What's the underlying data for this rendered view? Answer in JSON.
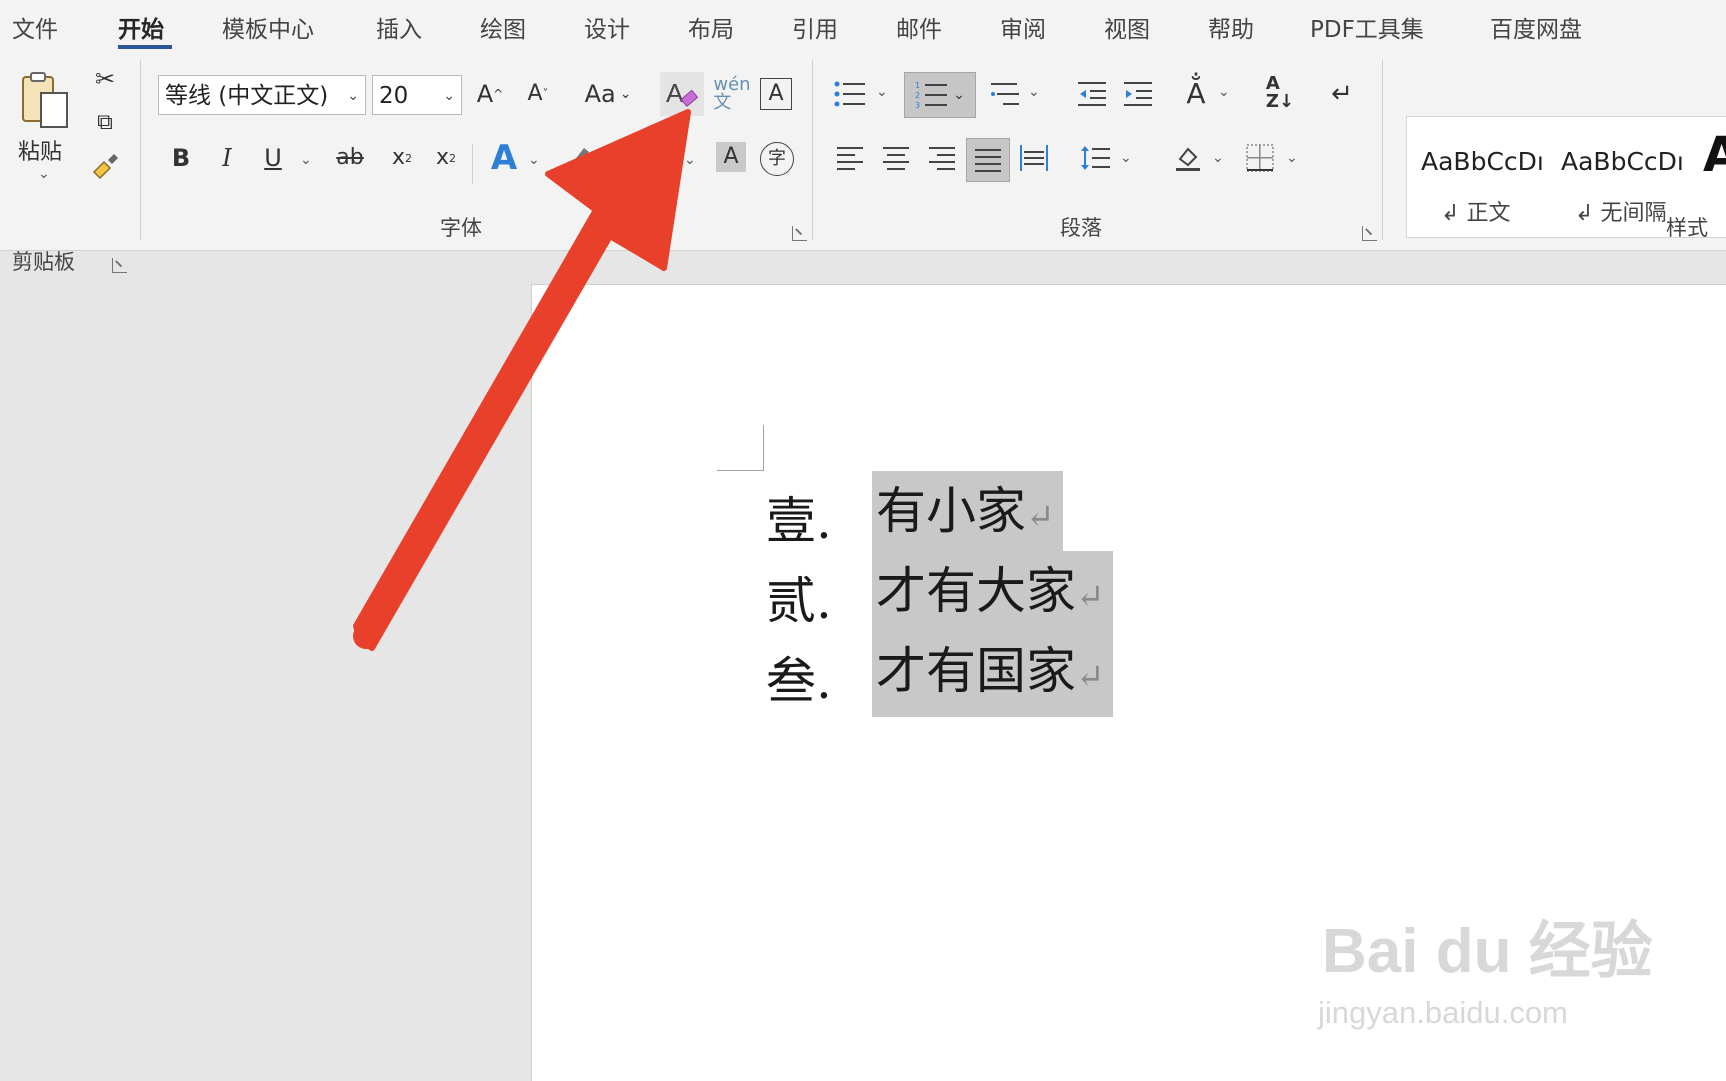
{
  "tabs": [
    {
      "label": "文件"
    },
    {
      "label": "开始",
      "active": true
    },
    {
      "label": "模板中心"
    },
    {
      "label": "插入"
    },
    {
      "label": "绘图"
    },
    {
      "label": "设计"
    },
    {
      "label": "布局"
    },
    {
      "label": "引用"
    },
    {
      "label": "邮件"
    },
    {
      "label": "审阅"
    },
    {
      "label": "视图"
    },
    {
      "label": "帮助"
    },
    {
      "label": "PDF工具集"
    },
    {
      "label": "百度网盘"
    }
  ],
  "clipboard": {
    "paste_label": "粘贴",
    "group_label": "剪贴板"
  },
  "font": {
    "font_name": "等线 (中文正文)",
    "font_size": "20",
    "change_case_label": "Aa",
    "group_label": "字体"
  },
  "paragraph": {
    "group_label": "段落"
  },
  "styles": {
    "items": [
      {
        "preview": "AaBbCcDı",
        "name": "正文"
      },
      {
        "preview": "AaBbCcDı",
        "name": "无间隔"
      }
    ],
    "group_label": "样式"
  },
  "document": {
    "list": [
      {
        "number": "壹.",
        "text": "有小家"
      },
      {
        "number": "贰.",
        "text": "才有大家"
      },
      {
        "number": "叁.",
        "text": "才有国家"
      }
    ],
    "paragraph_mark": "↵"
  },
  "watermark": {
    "brand": "Bai du 经验",
    "url": "jingyan.baidu.com"
  },
  "colors": {
    "accent": "#2b579a",
    "arrow": "#e8402a",
    "selection": "#c8c8c8"
  }
}
